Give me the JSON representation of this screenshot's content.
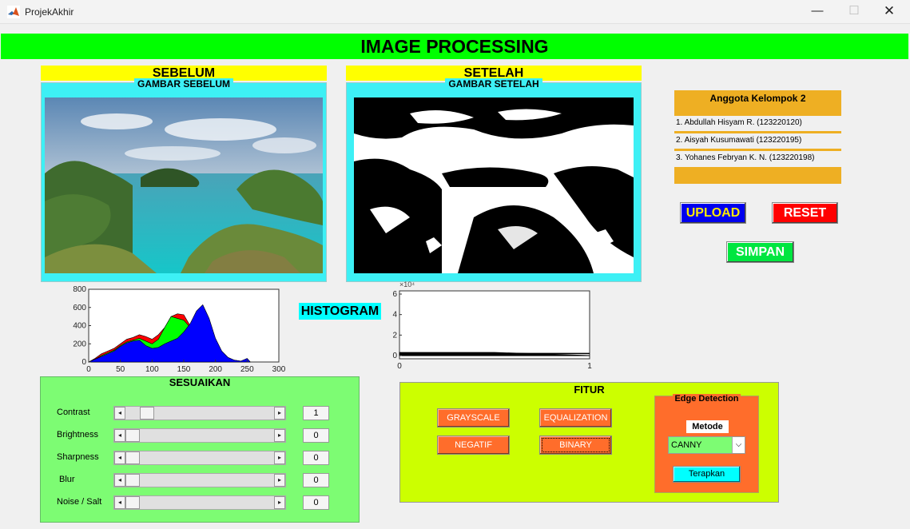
{
  "window": {
    "title": "ProjekAkhir",
    "minimize": "—",
    "maximize": "☐",
    "close": "✕"
  },
  "banner": "IMAGE PROCESSING",
  "before": {
    "header": "SEBELUM",
    "panel_label": "GAMBAR SEBELUM"
  },
  "after": {
    "header": "SETELAH",
    "panel_label": "GAMBAR SETELAH"
  },
  "members": {
    "title": "Anggota Kelompok 2",
    "list": [
      "1. Abdullah Hisyam R. (123220120)",
      "2. Aisyah Kusumawati (123220195)",
      "3. Yohanes Febryan K. N. (123220198)"
    ]
  },
  "buttons": {
    "upload": "UPLOAD",
    "reset": "RESET",
    "simpan": "SIMPAN"
  },
  "histogram_label": "HISTOGRAM",
  "hist_before_axes": {
    "y_ticks": [
      "800",
      "600",
      "400",
      "200",
      "0"
    ],
    "x_ticks": [
      "0",
      "50",
      "100",
      "150",
      "200",
      "250",
      "300"
    ]
  },
  "hist_after_axes": {
    "exponent": "×10⁴",
    "y_ticks": [
      "6",
      "4",
      "2",
      "0"
    ],
    "x_ticks": [
      "0",
      "1"
    ]
  },
  "chart_data": [
    {
      "type": "area",
      "xlim": [
        0,
        300
      ],
      "ylim": [
        0,
        800
      ],
      "series": [
        {
          "color": "#ff0000",
          "x": [
            0,
            10,
            20,
            30,
            40,
            50,
            60,
            70,
            80,
            90,
            100,
            110,
            120,
            130,
            140,
            150,
            160,
            170,
            180,
            190,
            200,
            210,
            220,
            230,
            240,
            250,
            255
          ],
          "values": [
            0,
            40,
            90,
            120,
            150,
            200,
            250,
            270,
            300,
            280,
            250,
            300,
            380,
            500,
            530,
            520,
            400,
            420,
            330,
            180,
            120,
            70,
            40,
            20,
            10,
            5,
            0
          ]
        },
        {
          "color": "#00ff00",
          "x": [
            0,
            10,
            20,
            30,
            40,
            50,
            60,
            70,
            80,
            90,
            100,
            110,
            120,
            130,
            140,
            150,
            160,
            170,
            180,
            190,
            200,
            210,
            220,
            230,
            240,
            250,
            255
          ],
          "values": [
            0,
            30,
            70,
            100,
            130,
            180,
            220,
            240,
            260,
            230,
            200,
            250,
            380,
            500,
            480,
            460,
            380,
            430,
            330,
            180,
            110,
            60,
            30,
            15,
            8,
            4,
            0
          ]
        },
        {
          "color": "#0000ff",
          "x": [
            0,
            10,
            20,
            30,
            40,
            50,
            60,
            70,
            80,
            90,
            100,
            110,
            120,
            130,
            140,
            150,
            160,
            170,
            180,
            190,
            200,
            210,
            220,
            230,
            240,
            250,
            255
          ],
          "values": [
            0,
            30,
            60,
            90,
            120,
            170,
            210,
            230,
            240,
            180,
            150,
            160,
            200,
            230,
            260,
            330,
            420,
            560,
            630,
            480,
            260,
            120,
            50,
            20,
            10,
            40,
            0
          ]
        }
      ]
    },
    {
      "type": "area",
      "xlim": [
        0,
        1
      ],
      "ylim": [
        0,
        6
      ],
      "y_exponent": 4,
      "series": [
        {
          "color": "#000000",
          "x": [
            0,
            0.5,
            1
          ],
          "values": [
            0.3,
            0.3,
            0.0
          ]
        }
      ]
    }
  ],
  "adjust": {
    "title": "SESUAIKAN",
    "rows": [
      {
        "label": "Contrast",
        "value": "1",
        "level": 0.1
      },
      {
        "label": "Brightness",
        "value": "0",
        "level": 0.0
      },
      {
        "label": "Sharpness",
        "value": "0",
        "level": 0.0
      },
      {
        "label": "Blur",
        "value": "0",
        "level": 0.0
      },
      {
        "label": "Noise / Salt",
        "value": "0",
        "level": 0.0
      }
    ]
  },
  "features": {
    "title": "FITUR",
    "grayscale": "GRAYSCALE",
    "equalization": "EQUALIZATION",
    "negatif": "NEGATIF",
    "binary": "BINARY"
  },
  "edge": {
    "title": "Edge Detection",
    "metode_label": "Metode",
    "selected": "CANNY",
    "apply": "Terapkan"
  }
}
